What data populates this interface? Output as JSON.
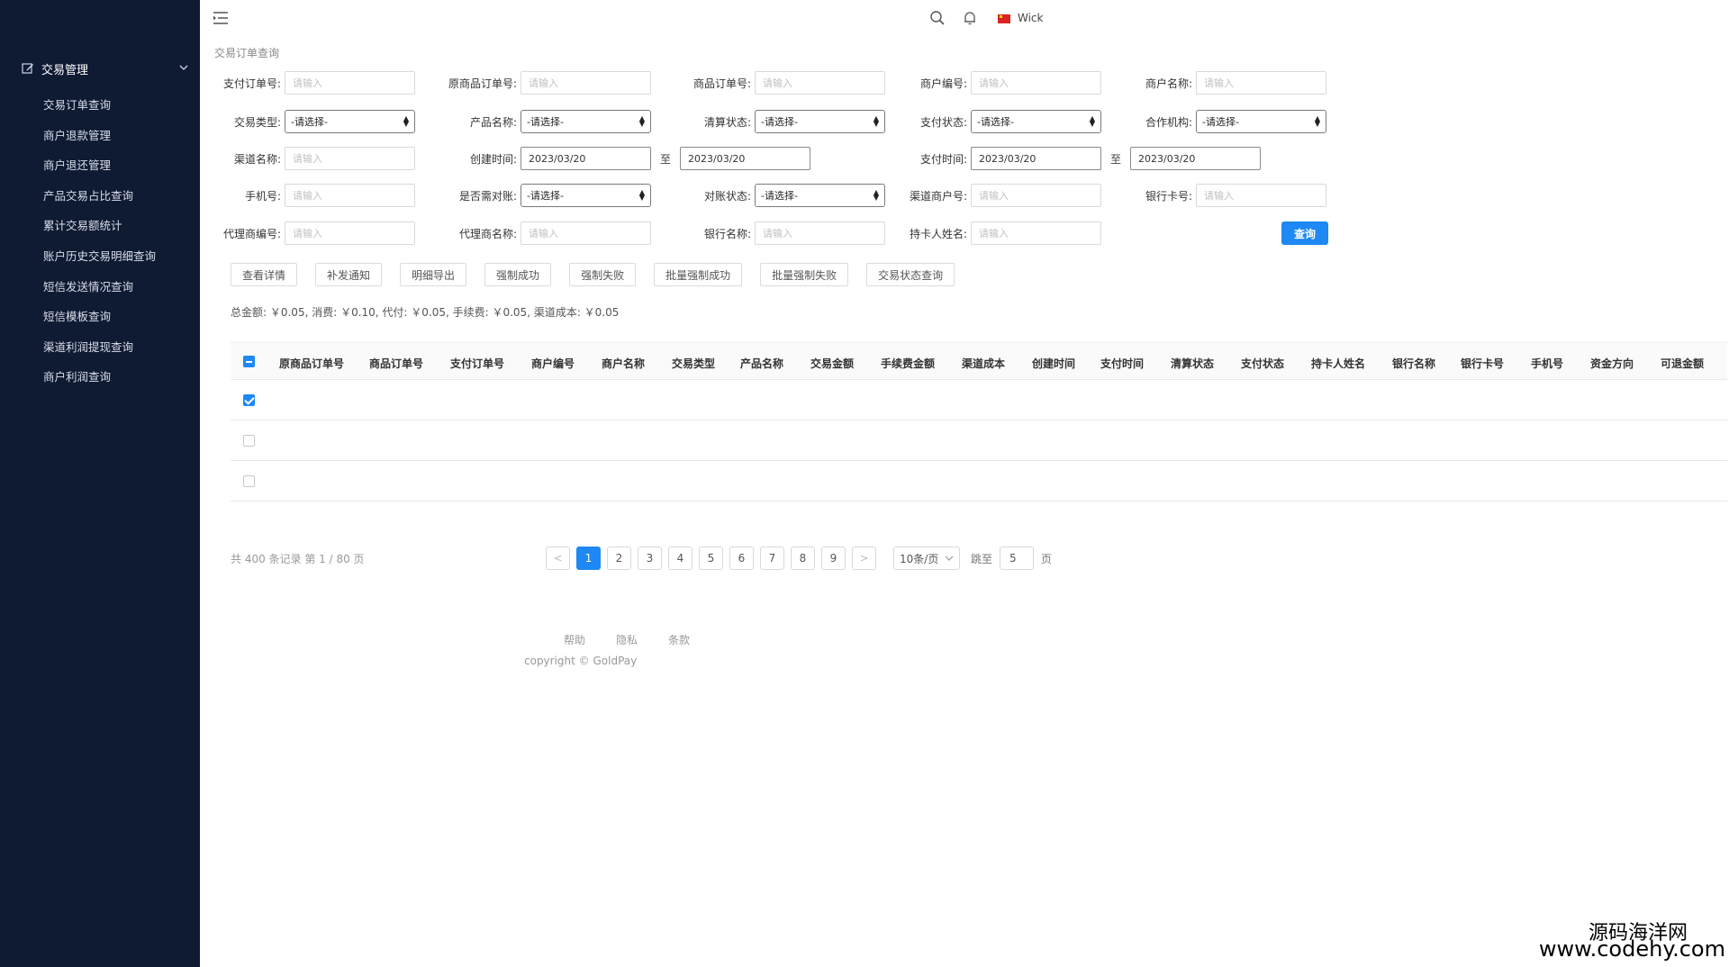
{
  "sidebar": {
    "group_label": "交易管理",
    "items": [
      {
        "label": "交易订单查询"
      },
      {
        "label": "商户退款管理"
      },
      {
        "label": "商户退还管理"
      },
      {
        "label": "产品交易占比查询"
      },
      {
        "label": "累计交易额统计"
      },
      {
        "label": "账户历史交易明细查询"
      },
      {
        "label": "短信发送情况查询"
      },
      {
        "label": "短信模板查询"
      },
      {
        "label": "渠道利润提现查询"
      },
      {
        "label": "商户利润查询"
      }
    ]
  },
  "topbar": {
    "user_name": "Wick"
  },
  "breadcrumb": "交易订单查询",
  "filters": {
    "input_placeholder": "请输入",
    "select_placeholder": "-请选择-",
    "to_label": "至",
    "pay_order_no": "支付订单号:",
    "orig_goods_order_no": "原商品订单号:",
    "goods_order_no": "商品订单号:",
    "merchant_no": "商户编号:",
    "merchant_name": "商户名称:",
    "trade_type": "交易类型:",
    "product_name": "产品名称:",
    "settle_status": "清算状态:",
    "pay_status": "支付状态:",
    "partner": "合作机构:",
    "channel_name": "渠道名称:",
    "create_time": "创建时间:",
    "create_from": "2023/03/20",
    "create_to": "2023/03/20",
    "pay_time": "支付时间:",
    "pay_from": "2023/03/20",
    "pay_to": "2023/03/20",
    "phone": "手机号:",
    "need_reconcile": "是否需对账:",
    "reconcile_status": "对账状态:",
    "channel_merchant_no": "渠道商户号:",
    "bank_card_no": "银行卡号:",
    "agent_no": "代理商编号:",
    "agent_name": "代理商名称:",
    "bank_name": "银行名称:",
    "holder_name": "持卡人姓名:",
    "query_button": "查询"
  },
  "actions": [
    "查看详情",
    "补发通知",
    "明细导出",
    "强制成功",
    "强制失败",
    "批量强制成功",
    "批量强制失败",
    "交易状态查询"
  ],
  "summary": "总金额: ￥0.05, 消费: ￥0.10, 代付: ￥0.05, 手续费: ￥0.05, 渠道成本: ￥0.05",
  "table": {
    "columns": [
      "原商品订单号",
      "商品订单号",
      "支付订单号",
      "商户编号",
      "商户名称",
      "交易类型",
      "产品名称",
      "交易金额",
      "手续费金额",
      "渠道成本",
      "创建时间",
      "支付时间",
      "清算状态",
      "支付状态",
      "持卡人姓名",
      "银行名称",
      "银行卡号",
      "手机号",
      "资金方向",
      "可退金额"
    ],
    "rows": [
      {
        "checked": true
      },
      {
        "checked": false
      },
      {
        "checked": false
      }
    ]
  },
  "pagination": {
    "total_text": "共 400 条记录 第 1 / 80 页",
    "prev": "<",
    "next": ">",
    "pages": [
      "1",
      "2",
      "3",
      "4",
      "5",
      "6",
      "7",
      "8",
      "9"
    ],
    "current": "1",
    "page_size": "10条/页",
    "jump_label": "跳至",
    "jump_value": "5",
    "page_label": "页"
  },
  "footer": {
    "links": [
      "帮助",
      "隐私",
      "条款"
    ],
    "copyright": "copyright © GoldPay"
  },
  "watermark": {
    "cn": "源码海洋网",
    "url": "www.codehy.com"
  },
  "colors": {
    "sidebar_bg": "#0f1a33",
    "primary": "#1e88f5"
  }
}
